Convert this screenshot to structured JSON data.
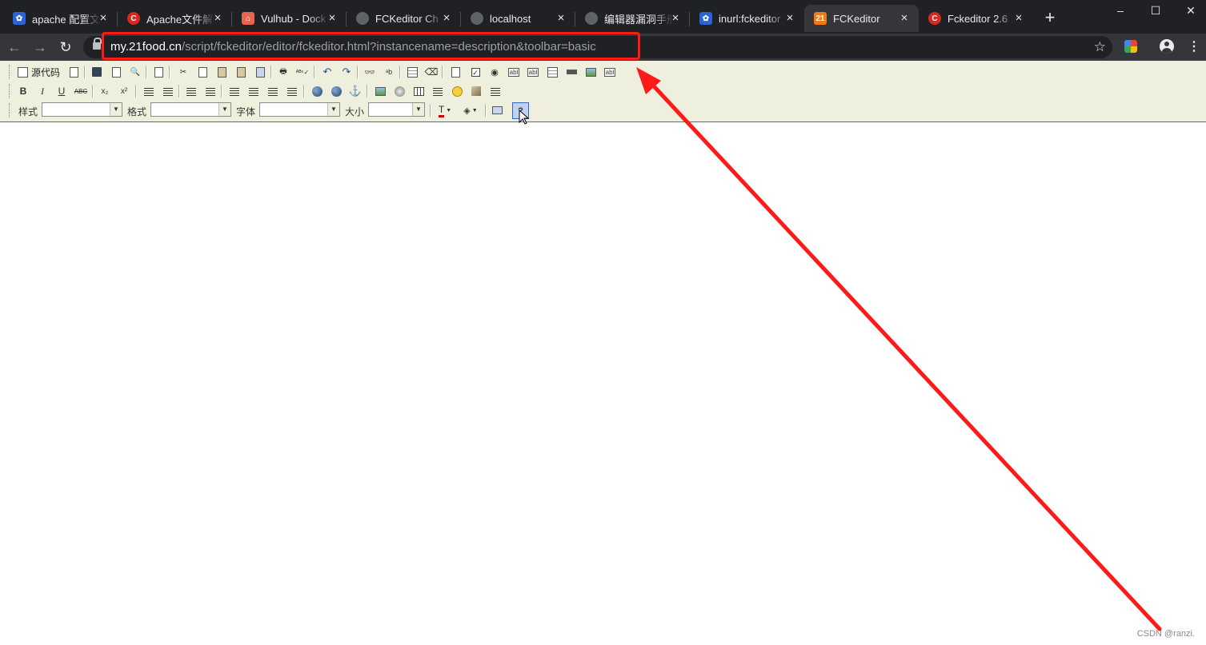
{
  "browser": {
    "tabs": [
      {
        "title": "apache 配置文",
        "favicon": "paw-icon",
        "favicon_text": "",
        "active": false
      },
      {
        "title": "Apache文件解",
        "favicon": "csdn-icon",
        "favicon_text": "C",
        "active": false
      },
      {
        "title": "Vulhub - Dock",
        "favicon": "vulhub-icon",
        "favicon_text": "",
        "active": false
      },
      {
        "title": "FCKeditor Ch",
        "favicon": "globe-icon",
        "favicon_text": "",
        "active": false
      },
      {
        "title": "localhost",
        "favicon": "globe-icon",
        "favicon_text": "",
        "active": false
      },
      {
        "title": "编辑器漏洞手册",
        "favicon": "globe-icon",
        "favicon_text": "",
        "active": false
      },
      {
        "title": "inurl:fckeditor",
        "favicon": "paw-icon",
        "favicon_text": "",
        "active": false
      },
      {
        "title": "FCKeditor",
        "favicon": "21food-icon",
        "favicon_text": "21",
        "active": true
      },
      {
        "title": "Fckeditor 2.6",
        "favicon": "csdn-icon",
        "favicon_text": "C",
        "active": false
      }
    ],
    "new_tab": "+",
    "window_controls": {
      "minimize": "–",
      "maximize": "☐",
      "close": "✕"
    },
    "nav": {
      "back": "←",
      "forward": "→",
      "reload": "↻"
    },
    "url": {
      "host": "my.21food.cn",
      "path": "/script/fckeditor/editor/fckeditor.html?instancename=description&toolbar=basic"
    },
    "bookmark_star": "☆",
    "menu": "⋮"
  },
  "toolbar": {
    "source_label": "源代码",
    "style_label": "样式",
    "format_label": "格式",
    "font_label": "字体",
    "size_label": "大小",
    "style_value": "",
    "format_value": "",
    "font_value": "",
    "size_value": "",
    "bold": "B",
    "italic": "I",
    "underline": "U",
    "strike": "ABC",
    "subscript": "x₂",
    "superscript": "x²",
    "abl": "abl"
  },
  "colors": {
    "annotation": "#ff1a1a",
    "toolbar_bg": "#efefde",
    "chrome_dark": "#202124",
    "chrome_mid": "#35363a"
  },
  "watermark": "CSDN @ranzi."
}
